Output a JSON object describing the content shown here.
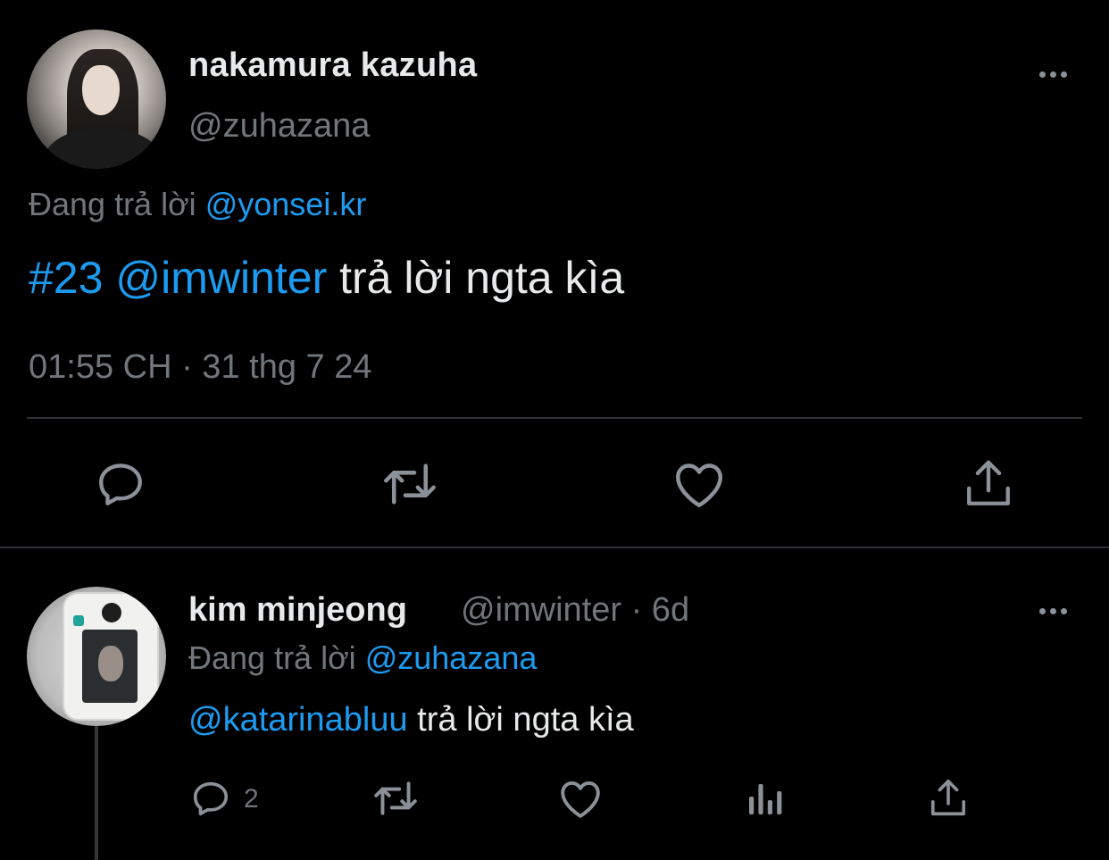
{
  "tweet": {
    "author_name": "nakamura kazuha",
    "author_handle": "@zuhazana",
    "replying_prefix": "Đang trả lời",
    "replying_to": "@yonsei.kr",
    "hashtag": "#23",
    "mention": "@imwinter",
    "text": "trả lời ngta kìa",
    "timestamp": "01:55 CH · 31 thg 7 24"
  },
  "reply": {
    "author_name": "kim minjeong",
    "author_meta": "@imwinter · 6d",
    "replying_prefix": "Đang trả lời",
    "replying_to": "@zuhazana",
    "mention": "@katarinabluu",
    "text": "trả lời ngta kìa",
    "reply_count": "2"
  },
  "colors": {
    "background": "#000000",
    "text": "#e7e9ea",
    "muted": "#71767b",
    "link": "#1d9bf0",
    "divider": "#2f3336"
  },
  "icons": [
    "more-icon",
    "reply-icon",
    "retweet-icon",
    "like-icon",
    "share-icon",
    "views-icon"
  ]
}
